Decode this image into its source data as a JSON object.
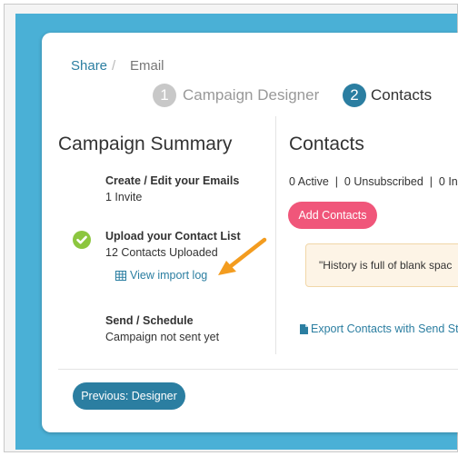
{
  "breadcrumb": {
    "share": "Share",
    "separator": "/",
    "email": "Email"
  },
  "steps": [
    {
      "number": "1",
      "label": "Campaign Designer"
    },
    {
      "number": "2",
      "label": "Contacts"
    }
  ],
  "summary": {
    "title": "Campaign Summary",
    "items": [
      {
        "title": "Create / Edit your Emails",
        "subtitle": "1 Invite"
      },
      {
        "title": "Upload your Contact List",
        "subtitle": "12 Contacts Uploaded",
        "link": "View import log"
      },
      {
        "title": "Send / Schedule",
        "subtitle": "Campaign not sent yet"
      }
    ]
  },
  "contacts": {
    "title": "Contacts",
    "stats": "0 Active  |  0 Unsubscribed  |  0 In",
    "add_button": "Add Contacts",
    "quote": "\"History is full of blank spac",
    "export_link": "Export Contacts with Send St"
  },
  "footer": {
    "previous_button": "Previous: Designer"
  },
  "colors": {
    "background": "#4ab0d6",
    "accent": "#2b7ea1",
    "pink": "#f0567a",
    "green": "#8cc63f",
    "arrow": "#f39c1f"
  }
}
